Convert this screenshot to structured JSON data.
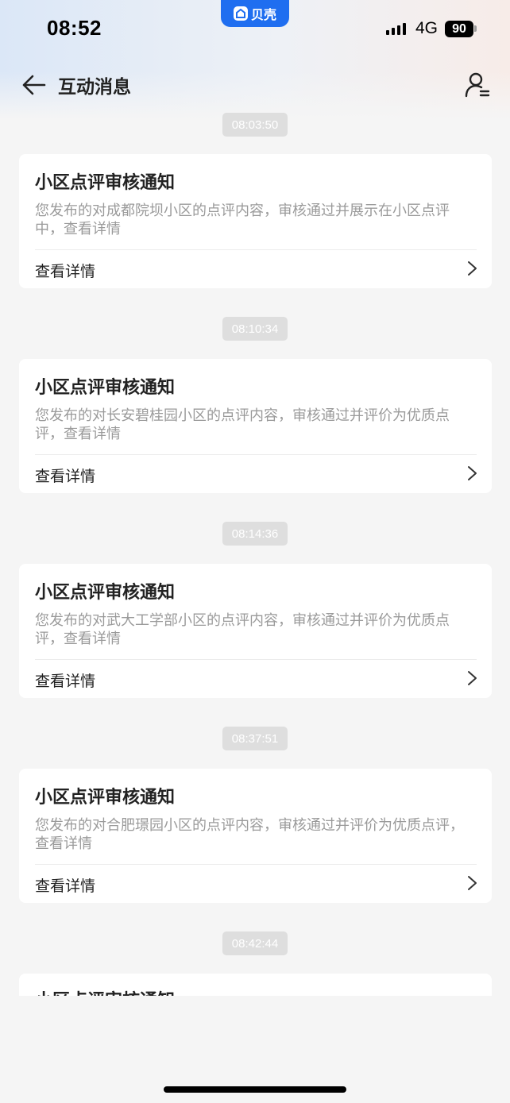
{
  "status_bar": {
    "time": "08:52",
    "network": "4G",
    "battery": "90"
  },
  "app_badge": {
    "label": "贝壳"
  },
  "nav": {
    "title": "互动消息"
  },
  "messages": [
    {
      "time": "08:03:50",
      "title": "小区点评审核通知",
      "desc": "您发布的对成都院坝小区的点评内容，审核通过并展示在小区点评中，查看详情",
      "link": "查看详情"
    },
    {
      "time": "08:10:34",
      "title": "小区点评审核通知",
      "desc": "您发布的对长安碧桂园小区的点评内容，审核通过并评价为优质点评，查看详情",
      "link": "查看详情"
    },
    {
      "time": "08:14:36",
      "title": "小区点评审核通知",
      "desc": "您发布的对武大工学部小区的点评内容，审核通过并评价为优质点评，查看详情",
      "link": "查看详情"
    },
    {
      "time": "08:37:51",
      "title": "小区点评审核通知",
      "desc": "您发布的对合肥璟园小区的点评内容，审核通过并评价为优质点评，查看详情",
      "link": "查看详情"
    },
    {
      "time": "08:42:44",
      "title": "小区点评审核通知"
    }
  ]
}
